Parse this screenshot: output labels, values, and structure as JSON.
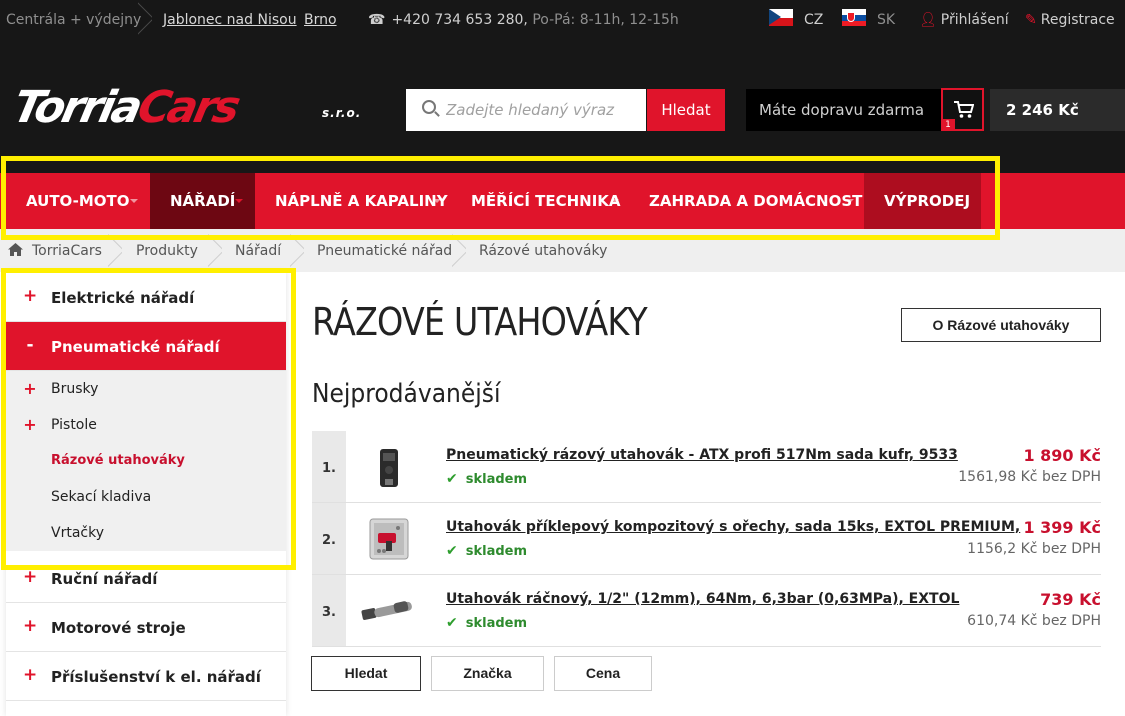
{
  "topbar": {
    "branch_label": "Centrála + výdejny",
    "branch_1": "Jablonec nad Nisou",
    "branch_2": "Brno",
    "phone": "+420 734 653 280,",
    "hours": "Po-Pá: 8-11h, 12-15h",
    "lang_cz": "CZ",
    "lang_sk": "SK",
    "login": "Přihlášení",
    "register": "Registrace"
  },
  "logo": {
    "part1": "Torria",
    "part2": "Cars",
    "suffix": "s.r.o."
  },
  "search": {
    "placeholder": "Zadejte hledaný výraz",
    "value": "",
    "button": "Hledat"
  },
  "cart": {
    "shipping_text": "Máte dopravu zdarma",
    "count": "1",
    "total": "2 246 Kč"
  },
  "nav": {
    "items": [
      {
        "label": "Auto-moto"
      },
      {
        "label": "Nářadí"
      },
      {
        "label": "Náplně a kapaliny"
      },
      {
        "label": "Měřící technika"
      },
      {
        "label": "Zahrada a domácnost"
      },
      {
        "label": "Výprodej"
      }
    ]
  },
  "breadcrumb": [
    "TorriaCars",
    "Produkty",
    "Nářadí",
    "Pneumatické nářadí",
    "Rázové utahováky"
  ],
  "sidebar": {
    "cat_electric": {
      "sign": "+",
      "label": "Elektrické nářadí"
    },
    "cat_pneumatic": {
      "sign": "-",
      "label": "Pneumatické nářadí"
    },
    "sub": [
      {
        "sign": "+",
        "label": "Brusky"
      },
      {
        "sign": "+",
        "label": "Pistole"
      },
      {
        "sign": "",
        "label": "Rázové utahováky"
      },
      {
        "sign": "",
        "label": "Sekací kladiva"
      },
      {
        "sign": "",
        "label": "Vrtačky"
      }
    ],
    "cat_hand": {
      "sign": "+",
      "label": "Ruční nářadí"
    },
    "cat_motor": {
      "sign": "+",
      "label": "Motorové stroje"
    },
    "cat_access": {
      "sign": "+",
      "label": "Příslušenství k el. nářadí"
    }
  },
  "content": {
    "title": "RÁZOVÉ UTAHOVÁKY",
    "about_button": "O Rázové utahováky",
    "section_title": "Nejprodávanější",
    "products": [
      {
        "rank": "1.",
        "name": "Pneumatický rázový utahovák - ATX profi 517Nm sada kufr, 9533",
        "stock": "skladem",
        "price": "1 890 Kč",
        "price_net": "1561,98 Kč bez DPH",
        "thumb_icon": "impact-wrench-case-image"
      },
      {
        "rank": "2.",
        "name": "Utahovák příklepový kompozitový s ořechy, sada 15ks, EXTOL PREMIUM,",
        "stock": "skladem",
        "price": "1 399 Kč",
        "price_net": "1156,2 Kč bez DPH",
        "thumb_icon": "impact-wrench-set-image"
      },
      {
        "rank": "3.",
        "name": "Utahovák ráčnový, 1/2\" (12mm), 64Nm, 6,3bar (0,63MPa), EXTOL",
        "stock": "skladem",
        "price": "739 Kč",
        "price_net": "610,74 Kč bez DPH",
        "thumb_icon": "ratchet-wrench-image"
      }
    ],
    "filters": {
      "search": "Hledat",
      "brand": "Značka",
      "price": "Cena"
    }
  },
  "colors": {
    "accent": "#e0142b",
    "highlight": "#ffef00",
    "dark": "#171717",
    "stock_green": "#2e8b2e"
  }
}
